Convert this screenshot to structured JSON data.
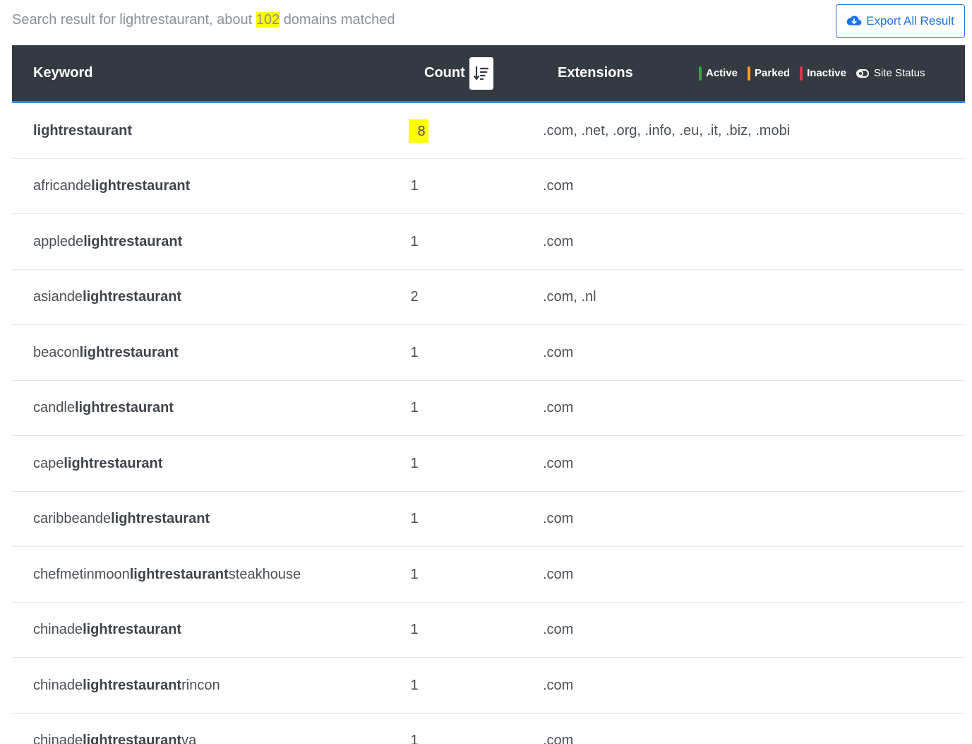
{
  "summary": {
    "prefix": "Search result for lightrestaurant, about ",
    "count": "102",
    "suffix": "domains matched"
  },
  "export_label": "Export All Result",
  "table": {
    "headers": {
      "keyword": "Keyword",
      "count": "Count",
      "extensions": "Extensions"
    },
    "legend": [
      {
        "label": "Active",
        "color": "#28a745"
      },
      {
        "label": "Parked",
        "color": "#fd9a22"
      },
      {
        "label": "Inactive",
        "color": "#dc3545"
      }
    ],
    "site_status_label": "Site Status",
    "rows": [
      {
        "pre": "",
        "kw": "lightrestaurant",
        "post": "",
        "count": "8",
        "ext": ".com, .net, .org, .info, .eu, .it, .biz, .mobi"
      },
      {
        "pre": "africande",
        "kw": "lightrestaurant",
        "post": "",
        "count": "1",
        "ext": ".com"
      },
      {
        "pre": "applede",
        "kw": "lightrestaurant",
        "post": "",
        "count": "1",
        "ext": ".com"
      },
      {
        "pre": "asiande",
        "kw": "lightrestaurant",
        "post": "",
        "count": "2",
        "ext": ".com, .nl"
      },
      {
        "pre": "beacon",
        "kw": "lightrestaurant",
        "post": "",
        "count": "1",
        "ext": ".com"
      },
      {
        "pre": "candle",
        "kw": "lightrestaurant",
        "post": "",
        "count": "1",
        "ext": ".com"
      },
      {
        "pre": "cape",
        "kw": "lightrestaurant",
        "post": "",
        "count": "1",
        "ext": ".com"
      },
      {
        "pre": "caribbeande",
        "kw": "lightrestaurant",
        "post": "",
        "count": "1",
        "ext": ".com"
      },
      {
        "pre": "chefmetinmoon",
        "kw": "lightrestaurant",
        "post": "steakhouse",
        "count": "1",
        "ext": ".com"
      },
      {
        "pre": "chinade",
        "kw": "lightrestaurant",
        "post": "",
        "count": "1",
        "ext": ".com"
      },
      {
        "pre": "chinade",
        "kw": "lightrestaurant",
        "post": "rincon",
        "count": "1",
        "ext": ".com"
      },
      {
        "pre": "chinade",
        "kw": "lightrestaurant",
        "post": "va",
        "count": "1",
        "ext": ".com"
      }
    ]
  }
}
